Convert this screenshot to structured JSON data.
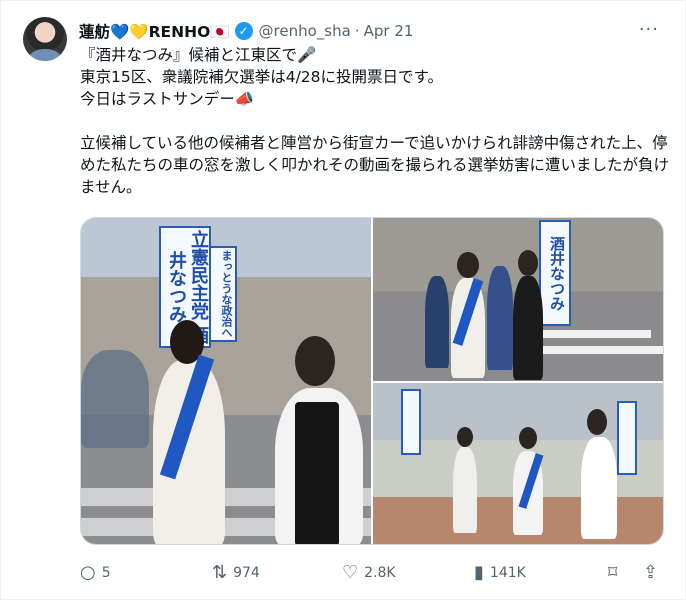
{
  "author": {
    "name": "蓮舫💙💛RENHO🇯🇵",
    "handle": "@renho_sha",
    "separator": "·",
    "date": "Apr 21",
    "verified_icon": "verified-badge-icon",
    "avatar_icon": "profile-avatar"
  },
  "more_icon": "···",
  "tweet": {
    "line1": "『酒井なつみ』候補と江東区で🎤",
    "line2": "東京15区、衆議院補欠選挙は4/28に投開票日です。",
    "line3": "今日はラストサンデー📣",
    "line4": "立候補している他の候補者と陣営から街宣カーで追いかけられ誹謗中傷された上、停めた私たちの車の窓を激しく叩かれその動画を撮られる選挙妨害に遭いましたが負けません。"
  },
  "photos": {
    "banner_text": "立憲民主党 酒井なつみ",
    "sash_text": "酒井なつみ",
    "banner_sub": "まっとうな政治へ"
  },
  "actions": {
    "replies": "5",
    "retweets": "974",
    "likes": "2.8K",
    "views": "141K"
  },
  "colors": {
    "accent": "#1d9bf0",
    "muted": "#536471",
    "sash_blue": "#1f57c3"
  }
}
